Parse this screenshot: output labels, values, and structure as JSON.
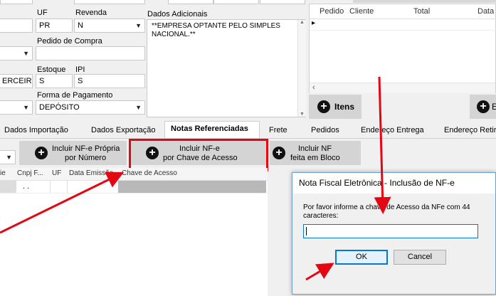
{
  "form": {
    "uf_label": "UF",
    "uf_value": "PR",
    "revenda_label": "Revenda",
    "revenda_value": "N",
    "dados_adicionais_label": "Dados Adicionais",
    "dados_adicionais_value": "**EMPRESA OPTANTE PELO SIMPLES NACIONAL.**",
    "pedido_compra_label": "Pedido de Compra",
    "estoque_label": "Estoque",
    "estoque_value": "S",
    "ipi_label": "IPI",
    "ipi_value": "S",
    "left_partial_value": "ERCEIR",
    "forma_pagamento_label": "Forma de Pagamento",
    "forma_pagamento_value": "DEPÓSITO"
  },
  "pedidos_grid": {
    "columns": [
      "Pedido",
      "Cliente",
      "Total",
      "Data"
    ],
    "row_indicator": "▸",
    "itens_button": "Itens",
    "partial_button": "E"
  },
  "tabs": [
    "Dados Importação",
    "Dados Exportação",
    "Notas Referenciadas",
    "Frete",
    "Pedidos",
    "Endereço Entrega",
    "Endereço Retira"
  ],
  "active_tab": "Notas Referenciadas",
  "toolbar": {
    "btn1_line1": "Incluir NF-e Própria",
    "btn1_line2": "por Número",
    "btn2_line1": "Incluir NF-e",
    "btn2_line2": "por Chave de Acesso",
    "btn3_line1": "Incluir NF",
    "btn3_line2": "feita em Bloco"
  },
  "notas_grid": {
    "columns": [
      "ie",
      "Cnpj F...",
      "UF",
      "Data Emissão",
      "Chave de Acesso"
    ],
    "row_value": ". ."
  },
  "dialog": {
    "title": "Nota Fiscal Eletrônica - Inclusão de NF-e",
    "message": "Por favor informe a chave de Acesso da NFe com 44 caracteres:",
    "input_value": "",
    "ok_label": "OK",
    "cancel_label": "Cancel"
  },
  "colors": {
    "highlight": "#e30613",
    "dialog_title_bg": "#ffffff",
    "ok_border": "#0078d7"
  }
}
